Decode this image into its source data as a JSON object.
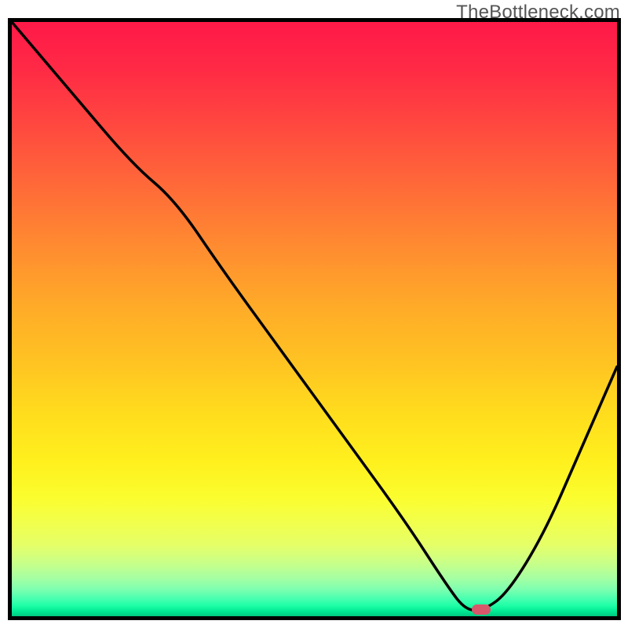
{
  "watermark": "TheBottleneck.com",
  "colors": {
    "frame": "#000000",
    "curve_stroke": "#000000",
    "dot_fill": "#d9576a",
    "gradient_top": "#ff1948",
    "gradient_bottom": "#00c97f"
  },
  "chart_data": {
    "type": "line",
    "title": "",
    "xlabel": "",
    "ylabel": "",
    "xlim": [
      0,
      100
    ],
    "ylim": [
      0,
      100
    ],
    "note": "No axis ticks or labels are shown. Values are estimated from visual position as percent of plot width (x) and height from bottom (y). The bottom ~6% of the chart is a green band; the minimum of the curve touches the bottom near x≈75-80.",
    "series": [
      {
        "name": "curve",
        "x": [
          0,
          10,
          20,
          27,
          35,
          45,
          55,
          65,
          72,
          75,
          78,
          82,
          88,
          94,
          100
        ],
        "y": [
          100,
          88,
          76,
          70,
          58,
          44,
          30,
          16,
          5,
          1,
          1,
          4,
          14,
          28,
          42
        ]
      }
    ],
    "marker": {
      "x": 77.5,
      "y": 0.8,
      "shape": "rounded-rect",
      "color": "#d9576a"
    },
    "background": "vertical gradient red→orange→yellow→green",
    "green_band_height_pct": 6
  }
}
